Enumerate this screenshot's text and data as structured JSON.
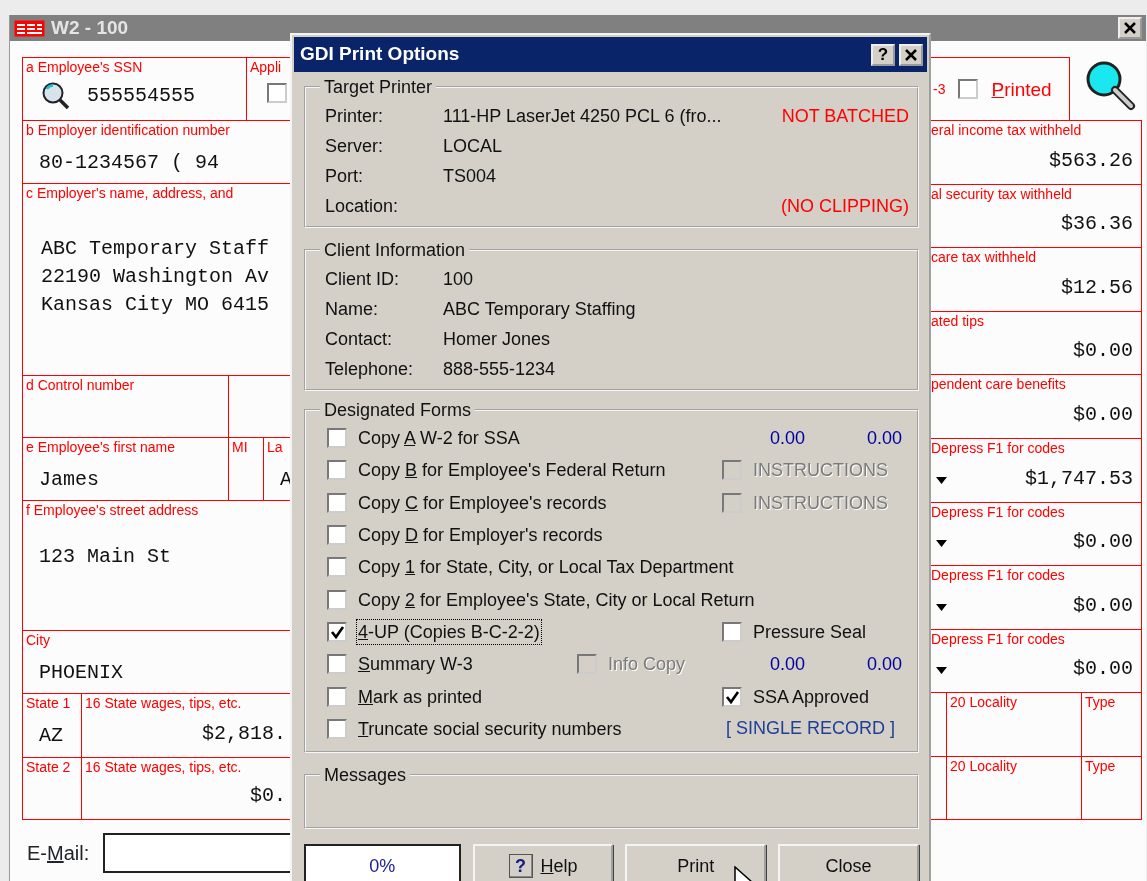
{
  "window": {
    "title": "W2 - 100"
  },
  "form_left": [
    {
      "cells": [
        {
          "kind": "lookup",
          "label": "a Employee's SSN",
          "value": "555554555"
        },
        {
          "kind": "check",
          "label": "Appli",
          "checked": false
        }
      ]
    },
    {
      "cells": [
        {
          "kind": "text",
          "label": "b Employer identification number",
          "value": "80-1234567 ( 94"
        }
      ]
    },
    {
      "cells": [
        {
          "kind": "lines",
          "label": "c Employer's name, address, and",
          "lines": [
            "ABC Temporary Staff",
            "22190 Washington Av",
            "Kansas City MO 6415"
          ]
        }
      ]
    },
    {
      "cells": [
        {
          "kind": "text",
          "label": "d Control number"
        }
      ]
    },
    {
      "cells": [
        {
          "kind": "text",
          "label": "e Employee's first name",
          "value": "James"
        },
        {
          "kind": "text",
          "label": "MI"
        },
        {
          "kind": "text",
          "label": "La",
          "value": "A"
        }
      ]
    },
    {
      "cells": [
        {
          "kind": "address",
          "label": "f Employee's street address",
          "value": "123 Main St"
        }
      ]
    },
    {
      "cells": [
        {
          "kind": "text",
          "label": "City",
          "value": "PHOENIX"
        }
      ]
    },
    {
      "cells": [
        {
          "kind": "text",
          "label": "State 1",
          "value": "AZ"
        },
        {
          "kind": "money",
          "label": "16 State wages, tips, etc.",
          "value": "$2,818."
        }
      ]
    },
    {
      "cells": [
        {
          "kind": "text",
          "label": "State 2"
        },
        {
          "kind": "money",
          "label": "16 State wages, tips, etc.",
          "value": "$0."
        }
      ]
    }
  ],
  "email": {
    "label": {
      "pre": "E-",
      "key": "M",
      "post": "ail:"
    }
  },
  "form_right": {
    "top": {
      "fragment": "-3",
      "checked": false,
      "label": {
        "key": "P",
        "post": "rinted"
      }
    },
    "rows": [
      {
        "cells": [
          {
            "kind": "money",
            "label": "eral income tax withheld",
            "value": "$563.26"
          }
        ]
      },
      {
        "cells": [
          {
            "kind": "money",
            "label": "al security tax withheld",
            "value": "$36.36"
          }
        ]
      },
      {
        "cells": [
          {
            "kind": "money",
            "label": "care tax withheld",
            "value": "$12.56"
          }
        ]
      },
      {
        "cells": [
          {
            "kind": "money",
            "label": "ated tips",
            "value": "$0.00"
          }
        ]
      },
      {
        "cells": [
          {
            "kind": "money",
            "label": "pendent care benefits",
            "value": "$0.00"
          }
        ]
      },
      {
        "cells": [
          {
            "kind": "code",
            "label": "Depress F1 for codes",
            "value": "$1,747.53"
          }
        ]
      },
      {
        "cells": [
          {
            "kind": "code",
            "label": "Depress F1 for codes",
            "value": "$0.00"
          }
        ]
      },
      {
        "cells": [
          {
            "kind": "code",
            "label": "Depress F1 for codes",
            "value": "$0.00"
          }
        ]
      },
      {
        "cells": [
          {
            "kind": "code",
            "label": "Depress F1 for codes",
            "value": "$0.00"
          }
        ]
      },
      {
        "cells": [
          {
            "kind": "blank"
          },
          {
            "kind": "text",
            "label": "20 Locality"
          },
          {
            "kind": "text",
            "label": "Type"
          }
        ]
      },
      {
        "cells": [
          {
            "kind": "blank"
          },
          {
            "kind": "text",
            "label": "20 Locality"
          },
          {
            "kind": "text",
            "label": "Type"
          }
        ]
      }
    ]
  },
  "dialog": {
    "title": "GDI Print Options",
    "help_button": "?",
    "target_printer": {
      "legend": "Target Printer",
      "rows": [
        {
          "label": "Printer:",
          "value": "111-HP LaserJet 4250 PCL 6 (fro...",
          "note": "NOT BATCHED"
        },
        {
          "label": "Server:",
          "value": "LOCAL"
        },
        {
          "label": "Port:",
          "value": "TS004"
        },
        {
          "label": "Location:",
          "note": "(NO CLIPPING)"
        }
      ]
    },
    "client_information": {
      "legend": "Client Information",
      "rows": [
        {
          "label": "Client ID:",
          "value": "100"
        },
        {
          "label": "Name:",
          "value": "ABC Temporary Staffing"
        },
        {
          "label": "Contact:",
          "value": "Homer Jones"
        },
        {
          "label": "Telephone:",
          "value": "888-555-1234"
        }
      ]
    },
    "designated_forms": {
      "legend": "Designated Forms",
      "rows": [
        {
          "checked": false,
          "focused": false,
          "label": {
            "pre": "Copy ",
            "key": "A",
            "post": " W-2 for SSA"
          },
          "right": {
            "kind": "amounts",
            "values": [
              "0.00",
              "0.00"
            ]
          }
        },
        {
          "checked": false,
          "focused": false,
          "label": {
            "pre": "Copy ",
            "key": "B",
            "post": " for Employee's Federal Return"
          },
          "right": {
            "kind": "check",
            "checked": false,
            "disabled": true,
            "text": "INSTRUCTIONS"
          }
        },
        {
          "checked": false,
          "focused": false,
          "label": {
            "pre": "Copy ",
            "key": "C",
            "post": " for Employee's records"
          },
          "right": {
            "kind": "check",
            "checked": false,
            "disabled": true,
            "text": "INSTRUCTIONS"
          }
        },
        {
          "checked": false,
          "focused": false,
          "label": {
            "pre": "Copy ",
            "key": "D",
            "post": " for Employer's records"
          }
        },
        {
          "checked": false,
          "focused": false,
          "label": {
            "pre": "Copy ",
            "key": "1",
            "post": " for State, City, or Local Tax Department"
          }
        },
        {
          "checked": false,
          "focused": false,
          "label": {
            "pre": "Copy ",
            "key": "2",
            "post": " for Employee's State, City or Local Return"
          }
        },
        {
          "checked": true,
          "focused": true,
          "label": {
            "key": "4",
            "post": "-UP (Copies B-C-2-2)"
          },
          "right": {
            "kind": "check",
            "checked": false,
            "disabled": false,
            "text": "Pressure Seal"
          }
        },
        {
          "checked": false,
          "focused": false,
          "label": {
            "key": "S",
            "post": "ummary W-3"
          },
          "middle": {
            "checked": false,
            "disabled": true,
            "text": "Info Copy"
          },
          "right": {
            "kind": "amounts",
            "values": [
              "0.00",
              "0.00"
            ]
          }
        },
        {
          "checked": false,
          "focused": false,
          "label": {
            "key": "M",
            "post": "ark as printed"
          },
          "right": {
            "kind": "check",
            "checked": true,
            "disabled": false,
            "text": "SSA Approved"
          }
        },
        {
          "checked": false,
          "focused": false,
          "label": {
            "key": "T",
            "post": "runcate social security numbers"
          },
          "right": {
            "kind": "note",
            "text": "[ SINGLE RECORD ]"
          }
        }
      ]
    },
    "messages": {
      "legend": "Messages"
    },
    "progress": {
      "text": "0%",
      "level": 0
    },
    "buttons": [
      {
        "kind": "help",
        "icon": "?",
        "label": {
          "key": "H",
          "post": "elp"
        }
      },
      {
        "kind": "plain",
        "label": {
          "pre": "Print"
        }
      },
      {
        "kind": "plain",
        "label": {
          "pre": "Close"
        }
      }
    ]
  }
}
